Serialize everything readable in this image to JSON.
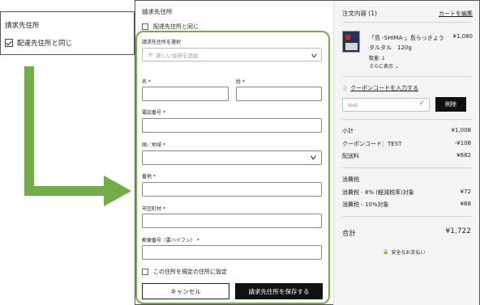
{
  "callout": {
    "title": "請求先住所",
    "checkbox_label": "配達先住所と同じ"
  },
  "colors": {
    "accent_green": "#72ad47",
    "primary_button": "#111111"
  },
  "form": {
    "title": "請求先住所",
    "same_as_shipping": "配達先住所と同じ",
    "select_label": "請求先住所を選択",
    "select_value": "新しい住所を追加",
    "first_name_label": "名 *",
    "last_name_label": "姓 *",
    "phone_label": "電話番号 *",
    "country_label": "国／地域 *",
    "street_label": "番地 *",
    "city_label": "市区町村 *",
    "zip_label": "郵便番号（要ハイフン） *",
    "default_label": "この住所を規定の住所に設定",
    "cancel_button": "キャンセル",
    "save_button": "請求先住所を保存する"
  },
  "summary": {
    "title": "注文内容 (1)",
    "edit_cart": "カートを編集",
    "product_name": "「島 -SHIMA-」島らっきょう タルタル　120g",
    "product_price": "¥1,080",
    "quantity": "数量: 1",
    "show_more": "さらに表示",
    "coupon_link": "クーポンコードを入力する",
    "coupon_value": "test",
    "delete_button": "削除",
    "subtotal_label": "小計",
    "subtotal_value": "¥1,008",
    "coupon_label": "クーポンコード：TEST",
    "coupon_discount": "-¥108",
    "shipping_label": "配送料",
    "shipping_value": "¥682",
    "tax_label": "消費税",
    "tax8_label": "消費税 - 8% (軽減税率)対象",
    "tax8_value": "¥72",
    "tax10_label": "消費税 - 10%対象",
    "tax10_value": "¥68",
    "total_label": "合計",
    "total_value": "¥1,722",
    "secure_text": "安全なお支払い"
  }
}
